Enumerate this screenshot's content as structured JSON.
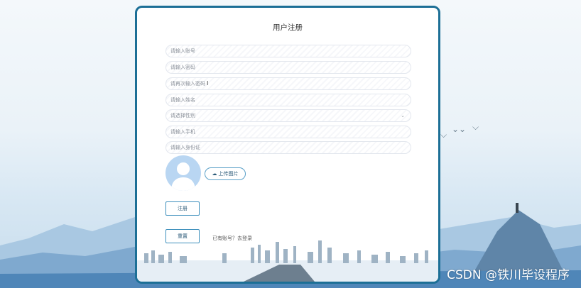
{
  "form": {
    "title": "用户注册",
    "account_placeholder": "请输入账号",
    "password_placeholder": "请输入密码",
    "confirm_placeholder": "请再次输入密码",
    "name_placeholder": "请输入姓名",
    "gender_placeholder": "请选择性别",
    "phone_placeholder": "请输入手机",
    "id_placeholder": "请输入身份证"
  },
  "upload": {
    "label": "上传图片",
    "icon": "cloud-upload-icon"
  },
  "buttons": {
    "register": "注册",
    "reset": "重置"
  },
  "login_link": "已有账号？去登录",
  "watermark": "CSDN @铁川毕设程序",
  "colors": {
    "card_border": "#1c6f96",
    "button_border": "#3d8fbc",
    "avatar_bg": "#b9d6f2"
  }
}
